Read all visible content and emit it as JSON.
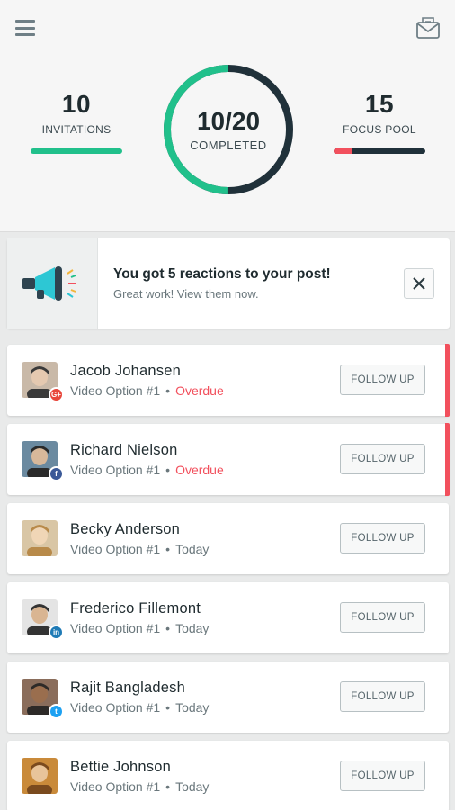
{
  "header": {
    "invitations": {
      "value": "10",
      "label": "INVITATIONS",
      "progress": 1.0
    },
    "completed": {
      "value": "10/20",
      "label": "COMPLETED",
      "progress": 0.5
    },
    "focus_pool": {
      "value": "15",
      "label": "FOCUS POOL",
      "alert_fraction": 0.2
    },
    "icons": {
      "menu": "hamburger-menu-icon",
      "mail": "mail-icon"
    }
  },
  "notification": {
    "title": "You got 5 reactions to your post!",
    "subtitle": "Great work!  View them now.",
    "icon": "megaphone-icon",
    "close_icon": "close-icon"
  },
  "colors": {
    "accent_green": "#21c08b",
    "dark_navy": "#20313a",
    "overdue_red": "#f2505d"
  },
  "contacts": [
    {
      "name": "Jacob Johansen",
      "option": "Video Option #1",
      "status": "Overdue",
      "overdue": true,
      "network": "google-plus",
      "badge_text": "G+",
      "badge_color": "#e8473b",
      "button": "FOLLOW UP"
    },
    {
      "name": "Richard Nielson",
      "option": "Video Option #1",
      "status": "Overdue",
      "overdue": true,
      "network": "facebook",
      "badge_text": "f",
      "badge_color": "#3b5998",
      "button": "FOLLOW UP"
    },
    {
      "name": "Becky Anderson",
      "option": "Video Option #1",
      "status": "Today",
      "overdue": false,
      "network": "",
      "badge_text": "",
      "badge_color": "",
      "button": "FOLLOW UP"
    },
    {
      "name": "Frederico Fillemont",
      "option": "Video Option #1",
      "status": "Today",
      "overdue": false,
      "network": "linkedin",
      "badge_text": "in",
      "badge_color": "#1f7bb6",
      "button": "FOLLOW UP"
    },
    {
      "name": "Rajit Bangladesh",
      "option": "Video Option #1",
      "status": "Today",
      "overdue": false,
      "network": "twitter",
      "badge_text": "t",
      "badge_color": "#1da1f2",
      "button": "FOLLOW UP"
    },
    {
      "name": "Bettie Johnson",
      "option": "Video Option #1",
      "status": "Today",
      "overdue": false,
      "network": "",
      "badge_text": "",
      "badge_color": "",
      "button": "FOLLOW UP"
    }
  ]
}
